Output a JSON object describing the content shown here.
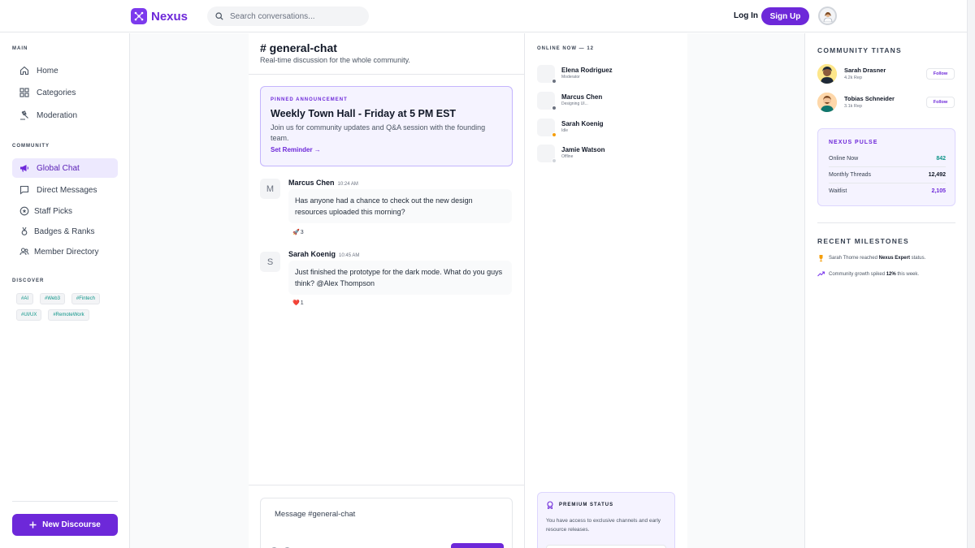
{
  "brand": {
    "name": "Nexus",
    "accent": "#6d28d9"
  },
  "header": {
    "search_placeholder": "Search conversations...",
    "login_label": "Log In",
    "signup_label": "Sign Up"
  },
  "sidebar": {
    "main_title": "MAIN",
    "main_items": [
      {
        "label": "Home",
        "icon": "home-icon"
      },
      {
        "label": "Categories",
        "icon": "grid-icon"
      },
      {
        "label": "Moderation",
        "icon": "gavel-icon"
      }
    ],
    "community_title": "COMMUNITY",
    "community_items": [
      {
        "label": "Global Chat",
        "icon": "megaphone-icon",
        "active": true
      },
      {
        "label": "Direct Messages",
        "icon": "message-icon"
      },
      {
        "label": "Staff Picks",
        "icon": "star-icon"
      },
      {
        "label": "Badges & Ranks",
        "icon": "medal-icon"
      },
      {
        "label": "Member Directory",
        "icon": "users-icon"
      }
    ],
    "discover_title": "DISCOVER",
    "tags": [
      "#AI",
      "#Web3",
      "#Fintech",
      "#UI/UX",
      "#RemoteWork"
    ],
    "new_button": "New Discourse"
  },
  "chat": {
    "channel": "# general-chat",
    "subtitle": "Real-time discussion for the whole community.",
    "pinned": {
      "label": "PINNED ANNOUNCEMENT",
      "title": "Weekly Town Hall - Friday at 5 PM EST",
      "body": "Join us for community updates and Q&A session with the founding team.",
      "link": "Set Reminder →"
    },
    "messages": [
      {
        "initial": "M",
        "author": "Marcus Chen",
        "time": "10:24 AM",
        "text": "Has anyone had a chance to check out the new design resources uploaded this morning?",
        "reaction": "🚀",
        "reaction_count": "3"
      },
      {
        "initial": "S",
        "author": "Sarah Koenig",
        "time": "10:45 AM",
        "text": "Just finished the prototype for the dark mode. What do you guys think? @Alex Thompson",
        "reaction": "❤️",
        "reaction_count": "1"
      }
    ],
    "composer_placeholder": "Message #general-chat"
  },
  "online": {
    "title": "ONLINE NOW — 12",
    "people": [
      {
        "name": "Elena Rodriguez",
        "status": "Moderator",
        "color": "#6b7280"
      },
      {
        "name": "Marcus Chen",
        "status": "Designing UI...",
        "color": "#6b7280"
      },
      {
        "name": "Sarah Koenig",
        "status": "Idle",
        "color": "#f59e0b"
      },
      {
        "name": "Jamie Watson",
        "status": "Offline",
        "color": "#d1d5db"
      }
    ],
    "premium": {
      "title": "PREMIUM STATUS",
      "body": "You have access to exclusive channels and early resource releases."
    }
  },
  "right": {
    "titans_title": "COMMUNITY TITANS",
    "titans": [
      {
        "name": "Sarah Drasner",
        "rep": "4.2k Rep",
        "follow": "Follow"
      },
      {
        "name": "Tobias Schneider",
        "rep": "3.1k Rep",
        "follow": "Follow"
      }
    ],
    "pulse": {
      "title": "NEXUS PULSE",
      "rows": [
        {
          "label": "Online Now",
          "value": "842",
          "color": "#0d9488"
        },
        {
          "label": "Monthly Threads",
          "value": "12,492",
          "color": "#111827"
        },
        {
          "label": "Waitlist",
          "value": "2,105",
          "color": "#6d28d9"
        }
      ]
    },
    "milestones_title": "RECENT MILESTONES",
    "milestones": [
      {
        "pre": "Sarah Thorne reached ",
        "bold": "Nexus Expert",
        "post": " status.",
        "icon": "trophy-icon"
      },
      {
        "pre": "Community growth spiked ",
        "bold": "12%",
        "post": " this week.",
        "icon": "trend-up-icon"
      }
    ]
  }
}
